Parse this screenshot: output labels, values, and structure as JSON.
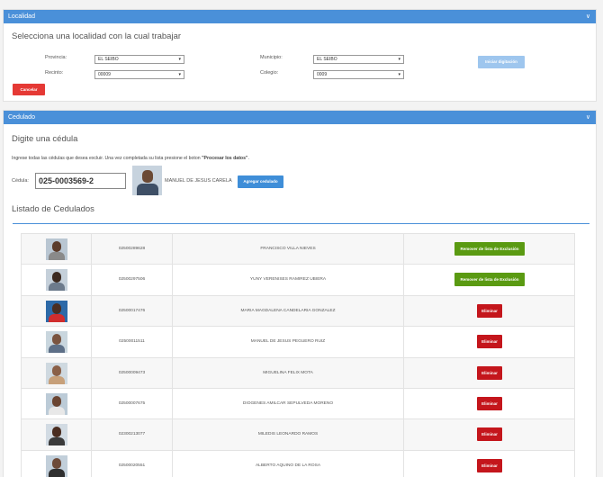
{
  "localidad": {
    "header": "Localidad",
    "subtitle": "Selecciona una localidad con la cual trabajar",
    "provincia_label": "Provincia:",
    "provincia_value": "EL SEIBO",
    "municipio_label": "Municipio:",
    "municipio_value": "EL SEIBO",
    "recinto_label": "Recinto:",
    "recinto_value": "00009",
    "colegio_label": "Colegio:",
    "colegio_value": "0009",
    "iniciar_label": "Iniciar digitación",
    "cancelar_label": "Cancelar"
  },
  "cedulado": {
    "header": "Cedulado",
    "subtitle": "Digite una cédula",
    "hint_prefix": "Ingrese todas las cédulas que desea excluir. Una vez completada su lista presione el boton ",
    "hint_bold": "\"Procesar los datos\"",
    "hint_suffix": ".",
    "cedula_label": "Cédula:",
    "cedula_value": "025-0003569-2",
    "found_name": "MANUEL DE JESUS CARELA",
    "agregar_label": "Agregar cedulado",
    "listado_title": "Listado de Cedulados"
  },
  "rows": [
    {
      "cedula": "02500289628",
      "name": "FRANCISCO VILLA NIEVES",
      "action": "Remover de lista de Exclusión",
      "kind": "green"
    },
    {
      "cedula": "02500297506",
      "name": "YUNY VERENISES RAMIREZ UBIERA",
      "action": "Remover de lista de Exclusión",
      "kind": "green"
    },
    {
      "cedula": "02500017476",
      "name": "MARIA MAGDALENA CANDELARIA GONZALEZ",
      "action": "Eliminar",
      "kind": "red"
    },
    {
      "cedula": "02500011511",
      "name": "MANUEL DE JESUS PEGUERO RUIZ",
      "action": "Eliminar",
      "kind": "red"
    },
    {
      "cedula": "02500009473",
      "name": "MIGUELINA FELIX MOTA",
      "action": "Eliminar",
      "kind": "red"
    },
    {
      "cedula": "02500007675",
      "name": "DIOGENES AMILCAR SEPULVEDA MORENO",
      "action": "Eliminar",
      "kind": "red"
    },
    {
      "cedula": "02300213077",
      "name": "MILEDIS LEONARDO RAMOS",
      "action": "Eliminar",
      "kind": "red"
    },
    {
      "cedula": "02500020551",
      "name": "ALBERTO AQUINO DE LA ROSA",
      "action": "Eliminar",
      "kind": "red"
    }
  ]
}
